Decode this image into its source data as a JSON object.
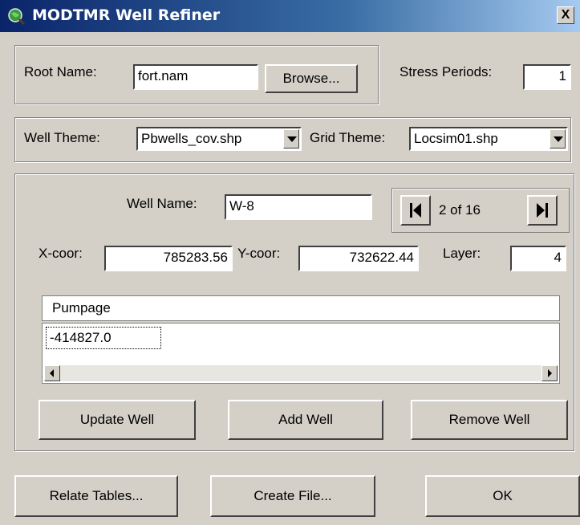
{
  "window": {
    "title": "MODTMR Well Refiner",
    "close_symbol": "X"
  },
  "root": {
    "label": "Root Name:",
    "value": "fort.nam",
    "browse_label": "Browse..."
  },
  "stress": {
    "label": "Stress Periods:",
    "value": "1"
  },
  "themes": {
    "well_label": "Well Theme:",
    "well_value": "Pbwells_cov.shp",
    "grid_label": "Grid Theme:",
    "grid_value": "Locsim01.shp"
  },
  "well": {
    "name_label": "Well Name:",
    "name_value": "W-8",
    "position": "2 of 16",
    "x_label": "X-coor:",
    "x_value": "785283.56",
    "y_label": "Y-coor:",
    "y_value": "732622.44",
    "layer_label": "Layer:",
    "layer_value": "4"
  },
  "grid": {
    "header": "Pumpage",
    "cell_value": "-414827.0"
  },
  "actions": {
    "update": "Update Well",
    "add": "Add Well",
    "remove": "Remove Well"
  },
  "footer": {
    "relate": "Relate Tables...",
    "create": "Create File...",
    "ok": "OK"
  }
}
